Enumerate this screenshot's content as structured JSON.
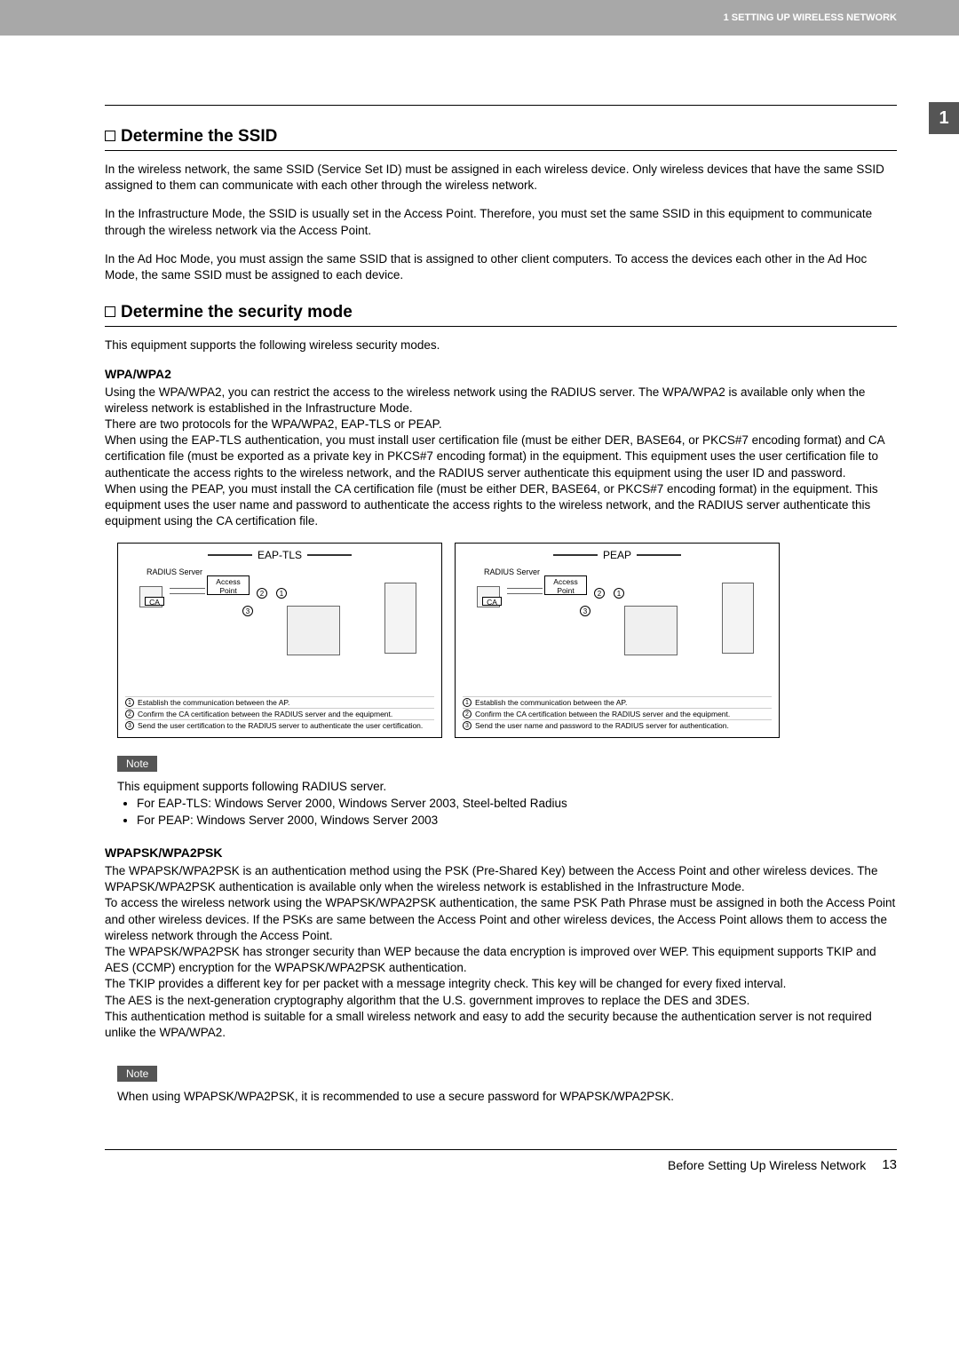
{
  "header": {
    "chapter_label": "1 SETTING UP WIRELESS NETWORK",
    "tab_number": "1"
  },
  "section_ssid": {
    "title": "Determine the SSID",
    "p1": "In the wireless network, the same SSID (Service Set ID) must be assigned in each wireless device.  Only wireless devices that have the same SSID assigned to them can communicate with each other through the wireless network.",
    "p2": "In the Infrastructure Mode, the SSID is usually set in the Access Point.  Therefore, you must set the same SSID in this equipment to communicate through the wireless network via the Access Point.",
    "p3": "In the Ad Hoc Mode, you must assign the same SSID that is assigned to other client computers.  To access the devices each other in the Ad Hoc Mode, the same SSID must be assigned to each device."
  },
  "section_security": {
    "title": "Determine the security mode",
    "intro": "This equipment supports the following wireless security modes."
  },
  "wpa": {
    "heading": "WPA/WPA2",
    "body": "Using the WPA/WPA2, you can restrict the access to the wireless network using the RADIUS server. The WPA/WPA2 is available only when the wireless network is established in the Infrastructure Mode.\nThere are two protocols for the WPA/WPA2, EAP-TLS or PEAP.\nWhen using the EAP-TLS authentication, you must install user certification file (must be either DER, BASE64, or PKCS#7 encoding format) and CA certification file (must be exported as a private key in PKCS#7 encoding format) in the equipment. This equipment uses the user certification file to authenticate the access rights to the wireless network, and the RADIUS server authenticate this equipment using the user ID and password.\nWhen using the PEAP, you must install the CA certification file (must be either DER, BASE64, or PKCS#7 encoding format) in the equipment. This equipment uses the user name and password to authenticate the access rights to the wireless network, and the RADIUS server authenticate this equipment using the CA certification file."
  },
  "diagram_eaptls": {
    "title": "EAP-TLS",
    "radius": "RADIUS Server",
    "ca": "CA",
    "ap": "Access Point",
    "step1": "Establish the communication between the AP.",
    "step2": "Confirm the CA certification between the RADIUS server and the equipment.",
    "step3": "Send the user certification to the RADIUS server to authenticate the user certification."
  },
  "diagram_peap": {
    "title": "PEAP",
    "radius": "RADIUS Server",
    "ca": "CA",
    "ap": "Access Point",
    "step1": "Establish the communication between the AP.",
    "step2": "Confirm the CA certification between the RADIUS server and the equipment.",
    "step3": "Send the user name and password to the RADIUS server for authentication."
  },
  "note1": {
    "label": "Note",
    "intro": "This equipment supports following RADIUS server.",
    "bullet1": "For EAP-TLS: Windows Server 2000, Windows Server 2003, Steel-belted Radius",
    "bullet2": "For PEAP: Windows Server 2000, Windows Server 2003"
  },
  "wpapsk": {
    "heading": "WPAPSK/WPA2PSK",
    "body": "The WPAPSK/WPA2PSK is an authentication method using the PSK (Pre-Shared Key) between the Access Point and other wireless devices. The WPAPSK/WPA2PSK authentication is available only when the wireless network is established in the Infrastructure Mode.\nTo access the wireless network using the WPAPSK/WPA2PSK authentication, the same PSK Path Phrase must be assigned in both the Access Point and other wireless devices. If the PSKs are same between the Access Point and other wireless devices, the Access Point allows them to access the wireless network through the Access Point.\nThe WPAPSK/WPA2PSK has stronger security than WEP because the data encryption is improved over WEP. This equipment supports TKIP and AES (CCMP) encryption for the WPAPSK/WPA2PSK authentication.\nThe TKIP provides a different key for per packet with a message integrity check.  This key will be changed for every fixed interval.\nThe AES is the next-generation cryptography algorithm that the U.S. government improves to replace the DES and 3DES.\nThis authentication method is suitable for a small wireless network and easy to add the security because the authentication server is not required unlike the WPA/WPA2."
  },
  "note2": {
    "label": "Note",
    "text": "When using WPAPSK/WPA2PSK, it is recommended to use a secure password for WPAPSK/WPA2PSK."
  },
  "footer": {
    "section": "Before Setting Up Wireless Network",
    "page": "13"
  }
}
